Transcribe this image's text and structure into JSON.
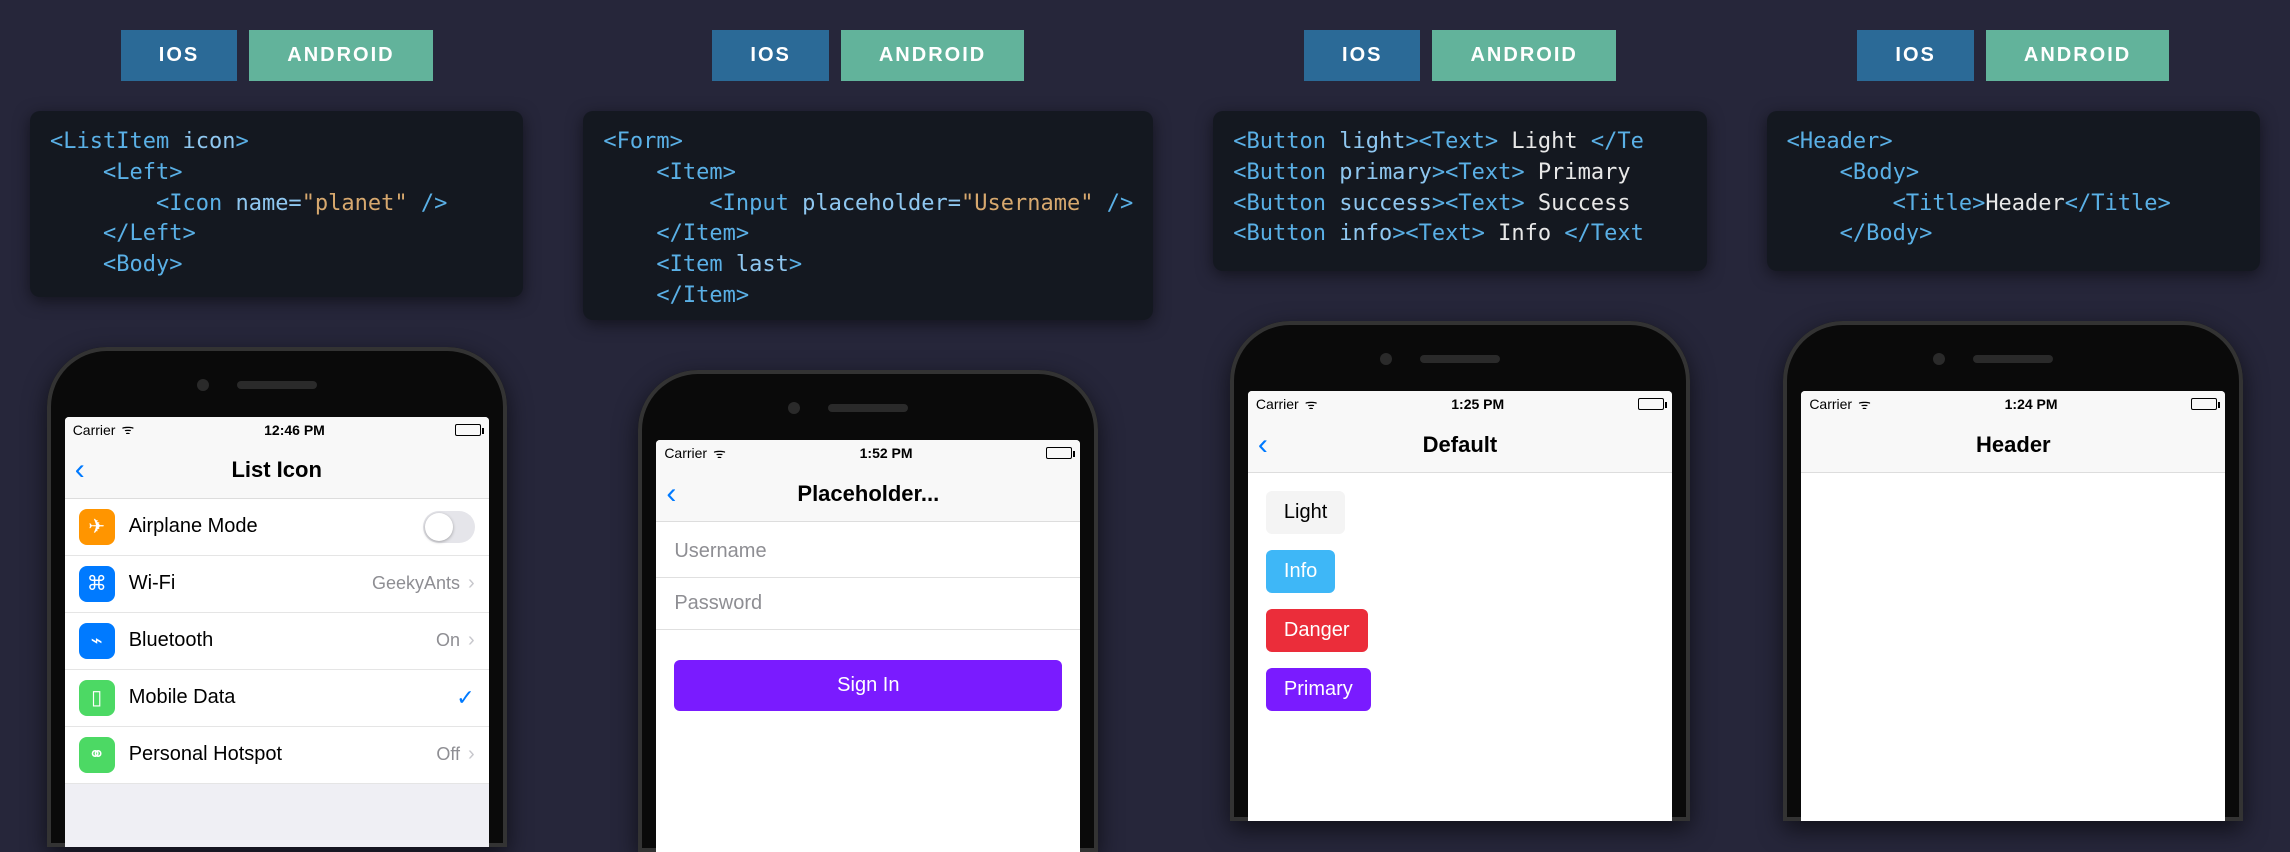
{
  "tabs": {
    "ios": "IOS",
    "android": "ANDROID"
  },
  "columns": [
    {
      "code": [
        [
          [
            "tag",
            "<ListItem "
          ],
          [
            "attr",
            "icon"
          ],
          [
            "tag",
            ">"
          ]
        ],
        [
          [
            "txt",
            "    "
          ],
          [
            "tag",
            "<Left>"
          ]
        ],
        [
          [
            "txt",
            "        "
          ],
          [
            "tag",
            "<Icon "
          ],
          [
            "attr",
            "name="
          ],
          [
            "val",
            "\"planet\""
          ],
          [
            "tag",
            " />"
          ]
        ],
        [
          [
            "txt",
            "    "
          ],
          [
            "tag",
            "</Left>"
          ]
        ],
        [
          [
            "txt",
            "    "
          ],
          [
            "tag",
            "<Body>"
          ]
        ]
      ],
      "phone": {
        "carrier": "Carrier",
        "time": "12:46 PM",
        "battery": "red",
        "title": "List Icon",
        "back": true,
        "list": [
          {
            "icon": "✈",
            "cls": "li-orange",
            "label": "Airplane Mode",
            "right_kind": "switch"
          },
          {
            "icon": "⌘",
            "cls": "li-blue",
            "label": "Wi-Fi",
            "right": "GeekyAnts",
            "chevron": true,
            "right_kind": "text"
          },
          {
            "icon": "⌁",
            "cls": "li-blue2",
            "label": "Bluetooth",
            "right": "On",
            "chevron": true,
            "right_kind": "text"
          },
          {
            "icon": "▯",
            "cls": "li-green",
            "label": "Mobile Data",
            "right_kind": "check"
          },
          {
            "icon": "⚭",
            "cls": "li-green2",
            "label": "Personal Hotspot",
            "right": "Off",
            "chevron": true,
            "right_kind": "text"
          }
        ]
      }
    },
    {
      "code": [
        [
          [
            "tag",
            "<Form>"
          ]
        ],
        [
          [
            "txt",
            "    "
          ],
          [
            "tag",
            "<Item>"
          ]
        ],
        [
          [
            "txt",
            "        "
          ],
          [
            "tag",
            "<Input "
          ],
          [
            "attr",
            "placeholder="
          ],
          [
            "val",
            "\"Username\""
          ],
          [
            "tag",
            " />"
          ]
        ],
        [
          [
            "txt",
            "    "
          ],
          [
            "tag",
            "</Item>"
          ]
        ],
        [
          [
            "txt",
            "    "
          ],
          [
            "tag",
            "<Item "
          ],
          [
            "attr",
            "last"
          ],
          [
            "tag",
            ">"
          ]
        ],
        [
          [
            "txt",
            "    "
          ],
          [
            "tag",
            "</Item>"
          ]
        ]
      ],
      "phone": {
        "carrier": "Carrier",
        "time": "1:52 PM",
        "battery": "green",
        "title": "Placeholder...",
        "back": true,
        "form": {
          "fields": [
            "Username",
            "Password"
          ],
          "submit": "Sign In"
        }
      }
    },
    {
      "code": [
        [
          [
            "tag",
            "<Button "
          ],
          [
            "attr",
            "light"
          ],
          [
            "tag",
            "><Text>"
          ],
          [
            "txt",
            " Light "
          ],
          [
            "tag",
            "</Te"
          ]
        ],
        [
          [
            "tag",
            "<Button "
          ],
          [
            "attr",
            "primary"
          ],
          [
            "tag",
            "><Text>"
          ],
          [
            "txt",
            " Primary "
          ]
        ],
        [
          [
            "tag",
            "<Button "
          ],
          [
            "attr",
            "success"
          ],
          [
            "tag",
            "><Text>"
          ],
          [
            "txt",
            " Success"
          ]
        ],
        [
          [
            "tag",
            "<Button "
          ],
          [
            "attr",
            "info"
          ],
          [
            "tag",
            "><Text>"
          ],
          [
            "txt",
            " Info "
          ],
          [
            "tag",
            "</Text"
          ]
        ]
      ],
      "phone": {
        "carrier": "Carrier",
        "time": "1:25 PM",
        "battery": "green",
        "title": "Default",
        "back": true,
        "buttons": [
          {
            "label": "Light",
            "cls": "b-light"
          },
          {
            "label": "Info",
            "cls": "b-info"
          },
          {
            "label": "Danger",
            "cls": "b-danger"
          },
          {
            "label": "Primary",
            "cls": "b-primary"
          }
        ]
      }
    },
    {
      "code": [
        [
          [
            "tag",
            "<Header>"
          ]
        ],
        [
          [
            "txt",
            "    "
          ],
          [
            "tag",
            "<Body>"
          ]
        ],
        [
          [
            "txt",
            "        "
          ],
          [
            "tag",
            "<Title>"
          ],
          [
            "txt",
            "Header"
          ],
          [
            "tag",
            "</Title>"
          ]
        ],
        [
          [
            "txt",
            "    "
          ],
          [
            "tag",
            "</Body>"
          ]
        ]
      ],
      "phone": {
        "carrier": "Carrier",
        "time": "1:24 PM",
        "battery": "green",
        "title": "Header",
        "back": false
      }
    }
  ]
}
